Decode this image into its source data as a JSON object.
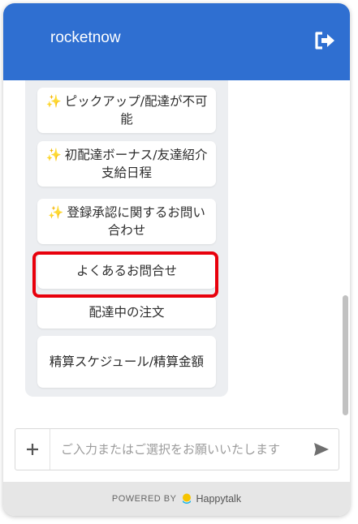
{
  "header": {
    "title": "rocketnow"
  },
  "menu": {
    "items": [
      {
        "sparkle": "✨",
        "label": "ピックアップ/配達が不可能"
      },
      {
        "sparkle": "✨",
        "label": "初配達ボーナス/友達紹介支給日程"
      },
      {
        "sparkle": "✨",
        "label": "登録承認に関するお問い合わせ"
      },
      {
        "label": "よくあるお問合せ"
      },
      {
        "label": "配達中の注文"
      },
      {
        "label": "精算スケジュール/精算金額"
      }
    ]
  },
  "composer": {
    "placeholder": "ご入力またはご選択をお願いいたします"
  },
  "footer": {
    "powered_by": "POWERED BY",
    "brand": "Happytalk"
  },
  "colors": {
    "header": "#2f6fd1",
    "highlight": "#e8000c",
    "sparkle": "#f2a61d"
  },
  "icons": {
    "logout": "logout-icon",
    "plus": "plus-icon",
    "send": "send-icon",
    "brand": "happytalk-logo-icon"
  }
}
